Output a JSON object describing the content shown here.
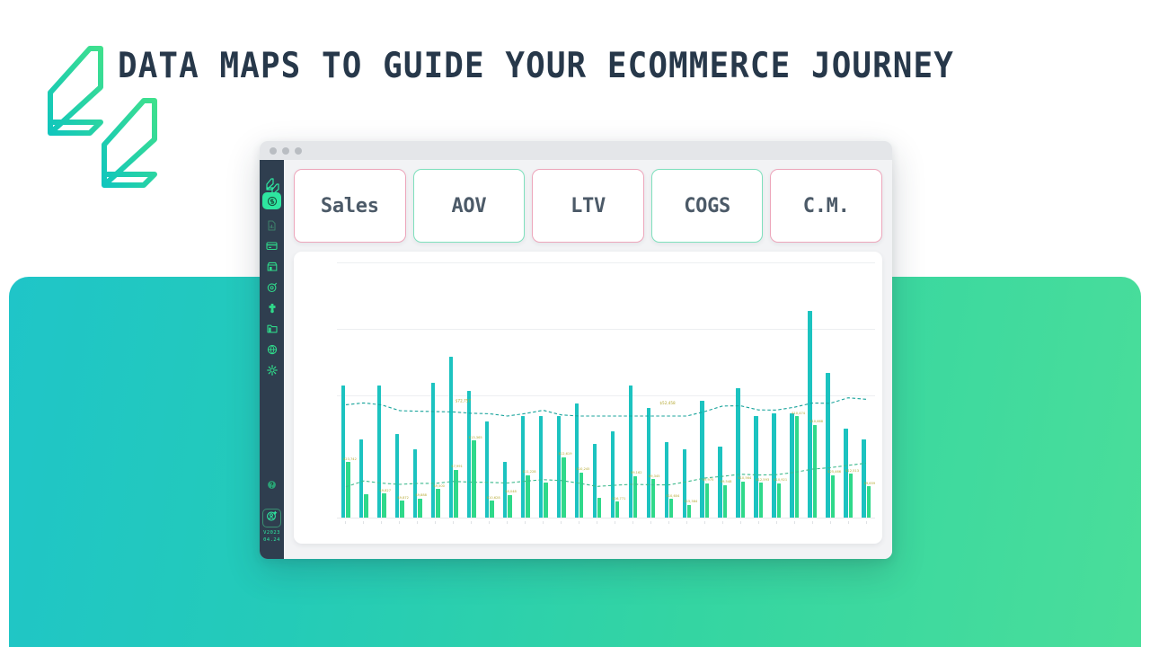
{
  "page": {
    "title": "DATA MAPS TO GUIDE YOUR ECOMMERCE JOURNEY",
    "background": "#ffffff"
  },
  "brand": {
    "logo_icon": "double-chevron-logo-icon",
    "gradient_start": "#16c4b8",
    "gradient_end": "#3fe08d"
  },
  "gradient_panel": {
    "left_color": "#1fc5c8",
    "right_color": "#4ade9a"
  },
  "window": {
    "traffic_lights": [
      "window-dot-red",
      "window-dot-yellow",
      "window-dot-green"
    ],
    "chrome_color": "#e4e6e9"
  },
  "sidebar": {
    "background": "#2f3e4f",
    "accent": "#2ee6a0",
    "logo_icon": "app-logo-icon",
    "items": [
      {
        "icon": "dollar-circle-icon",
        "label": "Revenue",
        "active": true,
        "top": 36
      },
      {
        "icon": "document-icon",
        "label": "Reports",
        "active": false,
        "top": 64
      },
      {
        "icon": "card-icon",
        "label": "Transactions",
        "active": false,
        "top": 87
      },
      {
        "icon": "store-icon",
        "label": "Store",
        "active": false,
        "top": 110
      },
      {
        "icon": "target-icon",
        "label": "Attribution",
        "active": false,
        "top": 133
      },
      {
        "icon": "puzzle-icon",
        "label": "Integrations",
        "active": false,
        "top": 156
      },
      {
        "icon": "folder-icon",
        "label": "Library",
        "active": false,
        "top": 179
      },
      {
        "icon": "globe-icon",
        "label": "Channels",
        "active": false,
        "top": 202
      },
      {
        "icon": "gear-icon",
        "label": "Settings",
        "active": false,
        "top": 225
      }
    ],
    "help_icon": "help-circle-icon",
    "account_icon": "add-user-icon",
    "version_line_1": "V2023",
    "version_line_2": "04.24"
  },
  "kpis": [
    {
      "label": "Sales",
      "accent": "pink"
    },
    {
      "label": "AOV",
      "accent": "green"
    },
    {
      "label": "LTV",
      "accent": "pink"
    },
    {
      "label": "COGS",
      "accent": "green"
    },
    {
      "label": "C.M.",
      "accent": "pink"
    }
  ],
  "chart_data": {
    "type": "bar",
    "title": "",
    "xlabel": "",
    "ylabel": "",
    "ylim": [
      0,
      100000
    ],
    "grid": true,
    "legend": "none",
    "value_label_color": "#b5a832",
    "series": [
      {
        "name": "Sales",
        "color": "#1cc3c0",
        "values": [
          52000,
          31000,
          52000,
          33000,
          27000,
          53000,
          63000,
          50000,
          38000,
          22000,
          40000,
          40000,
          40000,
          45000,
          29000,
          34000,
          52000,
          43000,
          30000,
          27000,
          46000,
          28000,
          51000,
          40000,
          41000,
          41000,
          81000,
          57000,
          35000,
          31000
        ]
      },
      {
        "name": "COGS",
        "color": "#2fd98a",
        "values": [
          22000,
          9500,
          9800,
          7000,
          7900,
          11500,
          19000,
          30500,
          7000,
          9300,
          17000,
          14000,
          24000,
          18000,
          8200,
          6600,
          16500,
          15300,
          7600,
          5400,
          13800,
          13000,
          14500,
          14000,
          13800,
          40000,
          36500,
          17000,
          17500,
          12500
        ]
      }
    ],
    "value_labels": [
      "$23,742",
      "",
      "$9,827",
      "$9,872",
      "$9,888",
      "$9,500",
      "$7,991",
      "$13,365",
      "$10,628",
      "$8,048",
      "$11,228",
      "",
      "$12,619",
      "$10,245",
      "",
      "$16,771",
      "$9,162",
      "$9,345",
      "$10,604",
      "$15,384",
      "$9,975",
      "$9,548",
      "$10,564",
      "$12,593",
      "$10,921",
      "$10,474",
      "$10,668",
      "$25,466",
      "$12,513",
      "$9,659"
    ],
    "trend_lines": [
      {
        "name": "Sales trend",
        "color": "#18a39b",
        "style": "dashed",
        "level": 0.58
      },
      {
        "name": "COGS trend",
        "color": "#3bb98c",
        "style": "dashed",
        "level": 0.22
      }
    ],
    "annotations": [
      {
        "text": "$72,757",
        "series": "Sales"
      },
      {
        "text": "$52,458",
        "series": "Sales"
      }
    ]
  }
}
